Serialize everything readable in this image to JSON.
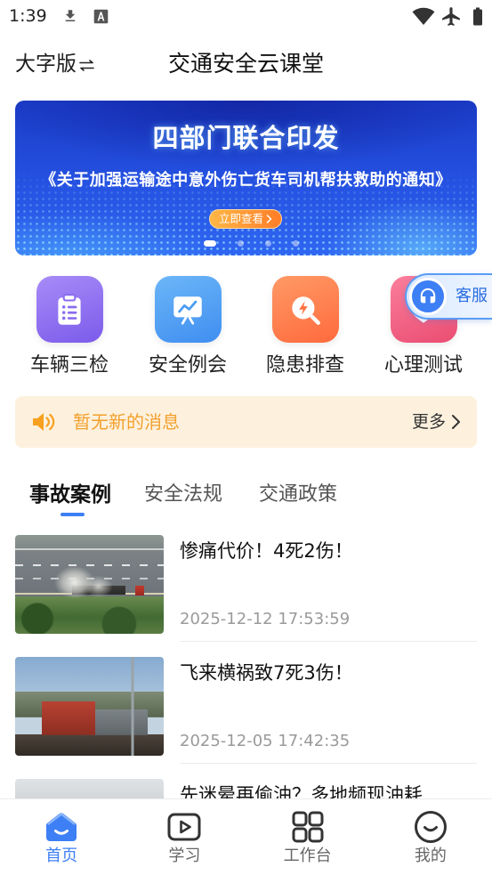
{
  "status_bar": {
    "time": "1:39",
    "icons": [
      "download-icon",
      "font-a-icon",
      "wifi-icon",
      "airplane-icon",
      "battery-icon"
    ]
  },
  "header": {
    "font_toggle_label": "大字版",
    "font_toggle_icon": "swap-icon",
    "title": "交通安全云课堂"
  },
  "banner": {
    "headline": "四部门联合印发",
    "subtitle": "《关于加强运输途中意外伤亡货车司机帮扶救助的通知》",
    "button_label": "立即查看",
    "button_icon": "chevron-right-icon",
    "slide_count": 4,
    "active_slide": 1
  },
  "quick_actions": [
    {
      "label": "车辆三检",
      "icon": "clipboard-icon",
      "color_from": "#A88BF8",
      "color_to": "#7B5BEA"
    },
    {
      "label": "安全例会",
      "icon": "presentation-icon",
      "color_from": "#6CB6F8",
      "color_to": "#3F8EF0"
    },
    {
      "label": "隐患排查",
      "icon": "search-alert-icon",
      "color_from": "#FF9A66",
      "color_to": "#FF6A3D"
    },
    {
      "label": "心理测试",
      "icon": "heart-icon",
      "color_from": "#FB7F9C",
      "color_to": "#EA4D72"
    }
  ],
  "customer_service": {
    "label": "客服",
    "icon": "headset-icon"
  },
  "notice": {
    "icon": "speaker-icon",
    "text": "暂无新的消息",
    "more_label": "更多",
    "more_icon": "chevron-right-icon"
  },
  "tabs": [
    {
      "label": "事故案例",
      "active": true
    },
    {
      "label": "安全法规",
      "active": false
    },
    {
      "label": "交通政策",
      "active": false
    }
  ],
  "articles": [
    {
      "title": "惨痛代价！4死2伤！",
      "date": "2025-12-12 17:53:59"
    },
    {
      "title": "飞来横祸致7死3伤！",
      "date": "2025-12-05 17:42:35"
    },
    {
      "title": "先迷晕再偷油？多地频现油耗"
    }
  ],
  "bottom_nav": [
    {
      "label": "首页",
      "icon": "home-icon",
      "active": true
    },
    {
      "label": "学习",
      "icon": "play-icon",
      "active": false
    },
    {
      "label": "工作台",
      "icon": "grid-icon",
      "active": false
    },
    {
      "label": "我的",
      "icon": "smile-icon",
      "active": false
    }
  ],
  "colors": {
    "accent": "#3D7FF5",
    "notice_background": "#FDF1DE",
    "notice_text": "#F2A02C",
    "date_text": "#9A9A9A"
  }
}
